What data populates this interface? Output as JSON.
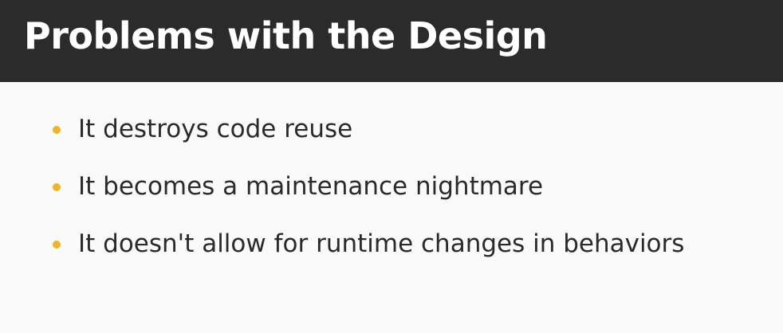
{
  "slide": {
    "title": "Problems with the Design",
    "bullets": [
      {
        "text": "It destroys code reuse"
      },
      {
        "text": "It becomes a maintenance nightmare"
      },
      {
        "text": "It doesn't allow for runtime changes in behaviors"
      }
    ]
  },
  "colors": {
    "title_bar": "#2b2b2b",
    "title_text": "#ffffff",
    "bullet_dot": "#f0b429",
    "body_text": "#2a2a2a",
    "background": "#fafafa"
  }
}
